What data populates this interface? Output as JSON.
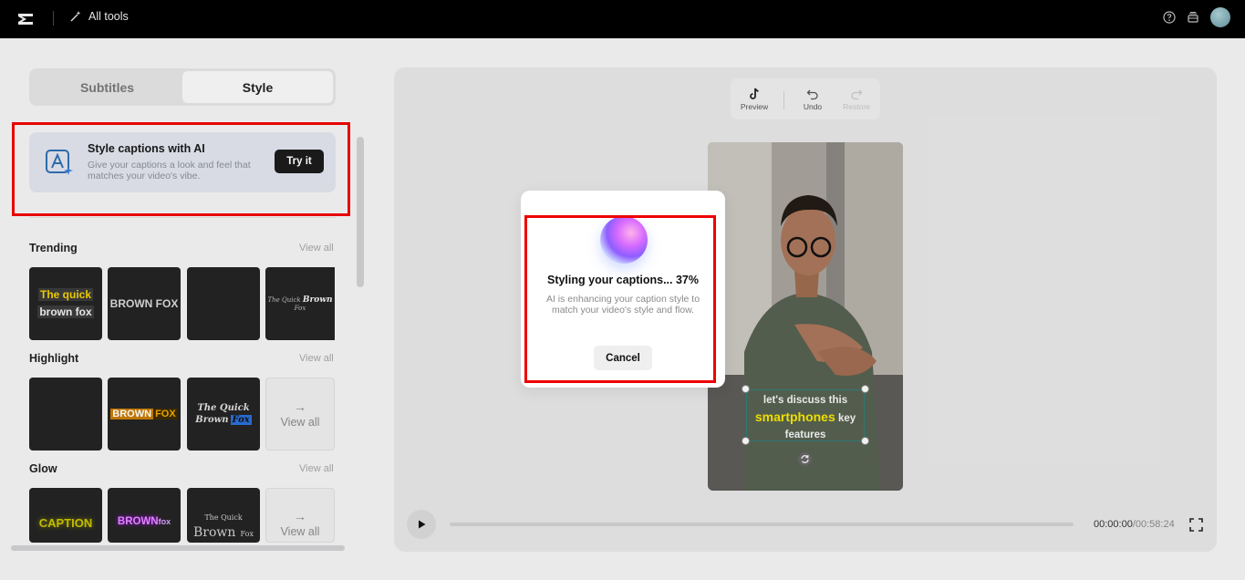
{
  "topbar": {
    "all_tools_label": "All tools",
    "icons": [
      "capcut-logo-icon",
      "magic-wand-icon",
      "help-icon",
      "inbox-icon",
      "avatar"
    ]
  },
  "tabs": [
    {
      "label": "Subtitles",
      "active": false
    },
    {
      "label": "Style",
      "active": true
    }
  ],
  "ai_card": {
    "title": "Style captions with AI",
    "description": "Give your captions a look and feel that matches your video's vibe.",
    "button_label": "Try it"
  },
  "sections": {
    "trending": {
      "title": "Trending",
      "view_all": "View all",
      "tiles": [
        {
          "line1": "The quick",
          "line2": "brown fox"
        },
        {
          "text": "BROWN FOX"
        },
        {
          "text": ""
        },
        {
          "text_a": "The Quick ",
          "text_b": "Brown",
          "text_c": " Fox"
        }
      ]
    },
    "highlight": {
      "title": "Highlight",
      "view_all": "View all",
      "tiles": [
        {
          "text": ""
        },
        {
          "text_a": "BROWN",
          "text_b": "FOX"
        },
        {
          "line1": "The Quick",
          "line2a": "Brown",
          "line2b": "Fox"
        }
      ],
      "view_all_tile": "View all"
    },
    "glow": {
      "title": "Glow",
      "view_all": "View all",
      "tiles": [
        {
          "text": "CAPTION"
        },
        {
          "text_a": "BROWN",
          "text_b": "fox"
        },
        {
          "line1": "The Quick",
          "line2a": "Brown",
          "line2b": "Fox"
        }
      ],
      "view_all_tile": "View all"
    }
  },
  "toolbar": {
    "preview_label": "Preview",
    "undo_label": "Undo",
    "redo_label": "Restore"
  },
  "video": {
    "caption_before": "let's discuss this",
    "caption_highlight": "smartphones",
    "caption_mid": "key",
    "caption_after": "features"
  },
  "player": {
    "current_time": "00:00:00",
    "duration": "/00:58:24",
    "progress": 0.0
  },
  "modal": {
    "title": "Styling your captions... 37%",
    "progress_percent": 37,
    "description": "AI is enhancing your caption style to match your video's style and flow.",
    "cancel_label": "Cancel"
  },
  "colors": {
    "topbar": "#000000",
    "accent_red": "#e00000",
    "caption_highlight": "#f5e500"
  }
}
